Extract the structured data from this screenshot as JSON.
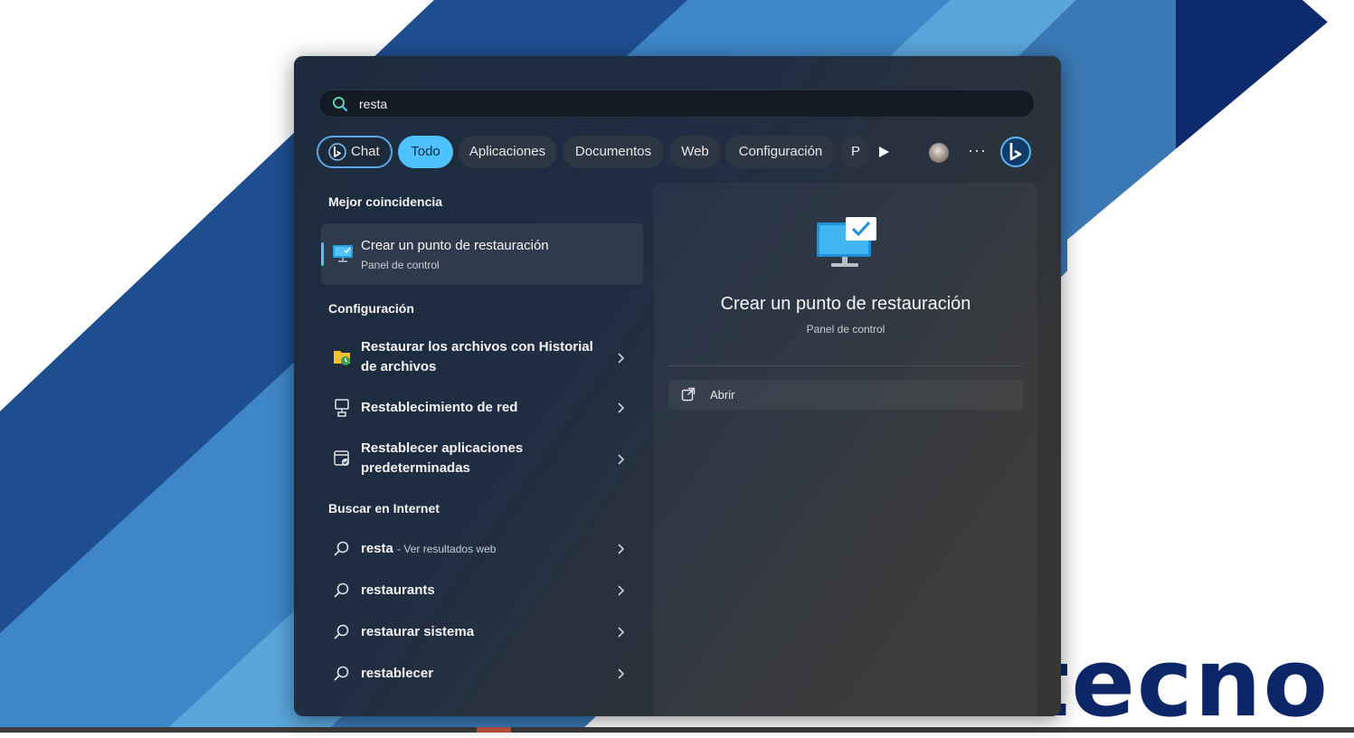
{
  "search": {
    "query": "resta"
  },
  "filters": {
    "items": [
      "Chat",
      "Todo",
      "Aplicaciones",
      "Documentos",
      "Web",
      "Configuración",
      "P"
    ],
    "active": "Todo"
  },
  "toolbar": {
    "more_label": "···"
  },
  "best_match": {
    "header": "Mejor coincidencia",
    "title": "Crear un punto de restauración",
    "subtitle": "Panel de control"
  },
  "settings": {
    "header": "Configuración",
    "items": [
      {
        "label_line1": "Restaurar los archivos con Historial",
        "label_line2": "de archivos",
        "icon": "file-history-icon"
      },
      {
        "label_line1": "Restablecimiento de red",
        "label_line2": "",
        "icon": "network-reset-icon"
      },
      {
        "label_line1": "Restablecer aplicaciones",
        "label_line2": "predeterminadas",
        "icon": "default-apps-icon"
      }
    ]
  },
  "web": {
    "header": "Buscar en Internet",
    "items": [
      {
        "query": "resta",
        "suffix": "- Ver resultados web"
      },
      {
        "query": "restaurants",
        "suffix": ""
      },
      {
        "query": "restaurar sistema",
        "suffix": ""
      },
      {
        "query": "restablecer",
        "suffix": ""
      }
    ]
  },
  "detail": {
    "title": "Crear un punto de restauración",
    "subtitle": "Panel de control",
    "action_label": "Abrir"
  },
  "background": {
    "brand_text": "tecno"
  },
  "colors": {
    "accent": "#4cc2ff",
    "panel": "#1f2d42",
    "brand": "#0c2668"
  }
}
